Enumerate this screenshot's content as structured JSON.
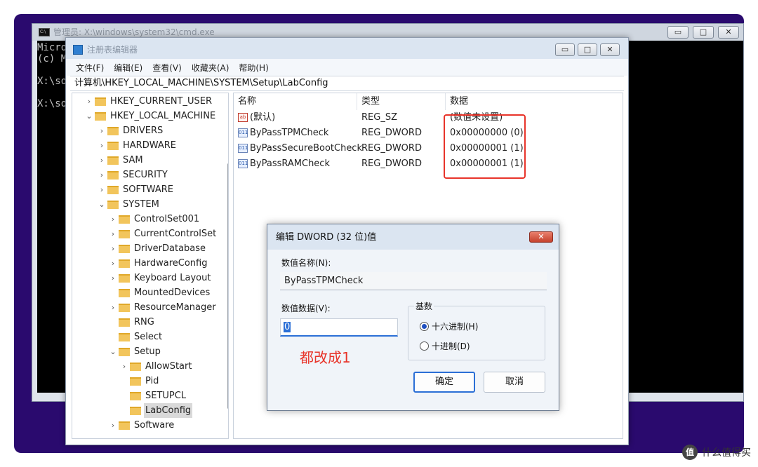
{
  "cmd": {
    "title": "管理员: X:\\windows\\system32\\cmd.exe",
    "lines": [
      "Micro",
      "(c) M",
      "",
      "X:\\so",
      "",
      "X:\\so"
    ],
    "buttons": {
      "minimize": "▭",
      "maximize": "□",
      "close": "✕"
    }
  },
  "regedit": {
    "title": "注册表编辑器",
    "buttons": {
      "minimize": "▭",
      "maximize": "□",
      "close": "✕"
    },
    "menu": [
      "文件(F)",
      "编辑(E)",
      "查看(V)",
      "收藏夹(A)",
      "帮助(H)"
    ],
    "address": "计算机\\HKEY_LOCAL_MACHINE\\SYSTEM\\Setup\\LabConfig",
    "tree": [
      {
        "label": "HKEY_CURRENT_USER",
        "chev": "›"
      },
      {
        "label": "HKEY_LOCAL_MACHINE",
        "chev": "⌄"
      },
      {
        "label": "DRIVERS",
        "chev": "›"
      },
      {
        "label": "HARDWARE",
        "chev": "›"
      },
      {
        "label": "SAM",
        "chev": "›"
      },
      {
        "label": "SECURITY",
        "chev": "›"
      },
      {
        "label": "SOFTWARE",
        "chev": "›"
      },
      {
        "label": "SYSTEM",
        "chev": "⌄"
      },
      {
        "label": "ControlSet001",
        "chev": "›"
      },
      {
        "label": "CurrentControlSet",
        "chev": "›"
      },
      {
        "label": "DriverDatabase",
        "chev": "›"
      },
      {
        "label": "HardwareConfig",
        "chev": "›"
      },
      {
        "label": "Keyboard Layout",
        "chev": "›"
      },
      {
        "label": "MountedDevices",
        "chev": ""
      },
      {
        "label": "ResourceManager",
        "chev": "›"
      },
      {
        "label": "RNG",
        "chev": ""
      },
      {
        "label": "Select",
        "chev": ""
      },
      {
        "label": "Setup",
        "chev": "⌄"
      },
      {
        "label": "AllowStart",
        "chev": "›"
      },
      {
        "label": "Pid",
        "chev": ""
      },
      {
        "label": "SETUPCL",
        "chev": ""
      },
      {
        "label": "LabConfig",
        "chev": ""
      },
      {
        "label": "Software",
        "chev": "›"
      }
    ],
    "columns": [
      "名称",
      "类型",
      "数据"
    ],
    "values": [
      {
        "icon": "ab",
        "name": "(默认)",
        "type": "REG_SZ",
        "data": "(数值未设置)"
      },
      {
        "icon": "011",
        "name": "ByPassTPMCheck",
        "type": "REG_DWORD",
        "data": "0x00000000 (0)"
      },
      {
        "icon": "011",
        "name": "ByPassSecureBootCheck",
        "type": "REG_DWORD",
        "data": "0x00000001 (1)"
      },
      {
        "icon": "011",
        "name": "ByPassRAMCheck",
        "type": "REG_DWORD",
        "data": "0x00000001 (1)"
      }
    ]
  },
  "dialog": {
    "title": "编辑 DWORD (32 位)值",
    "close": "✕",
    "name_label": "数值名称(N):",
    "name_value": "ByPassTPMCheck",
    "data_label": "数值数据(V):",
    "data_value": "0",
    "base_label": "基数",
    "radio_hex": "十六进制(H)",
    "radio_dec": "十进制(D)",
    "annotation": "都改成1",
    "ok": "确定",
    "cancel": "取消"
  },
  "watermark": {
    "icon": "值",
    "text": "什么值得买"
  },
  "colors": {
    "accent": "#2b6fd6",
    "annotation": "#e8342a",
    "desktop": "#2a0a6e"
  }
}
